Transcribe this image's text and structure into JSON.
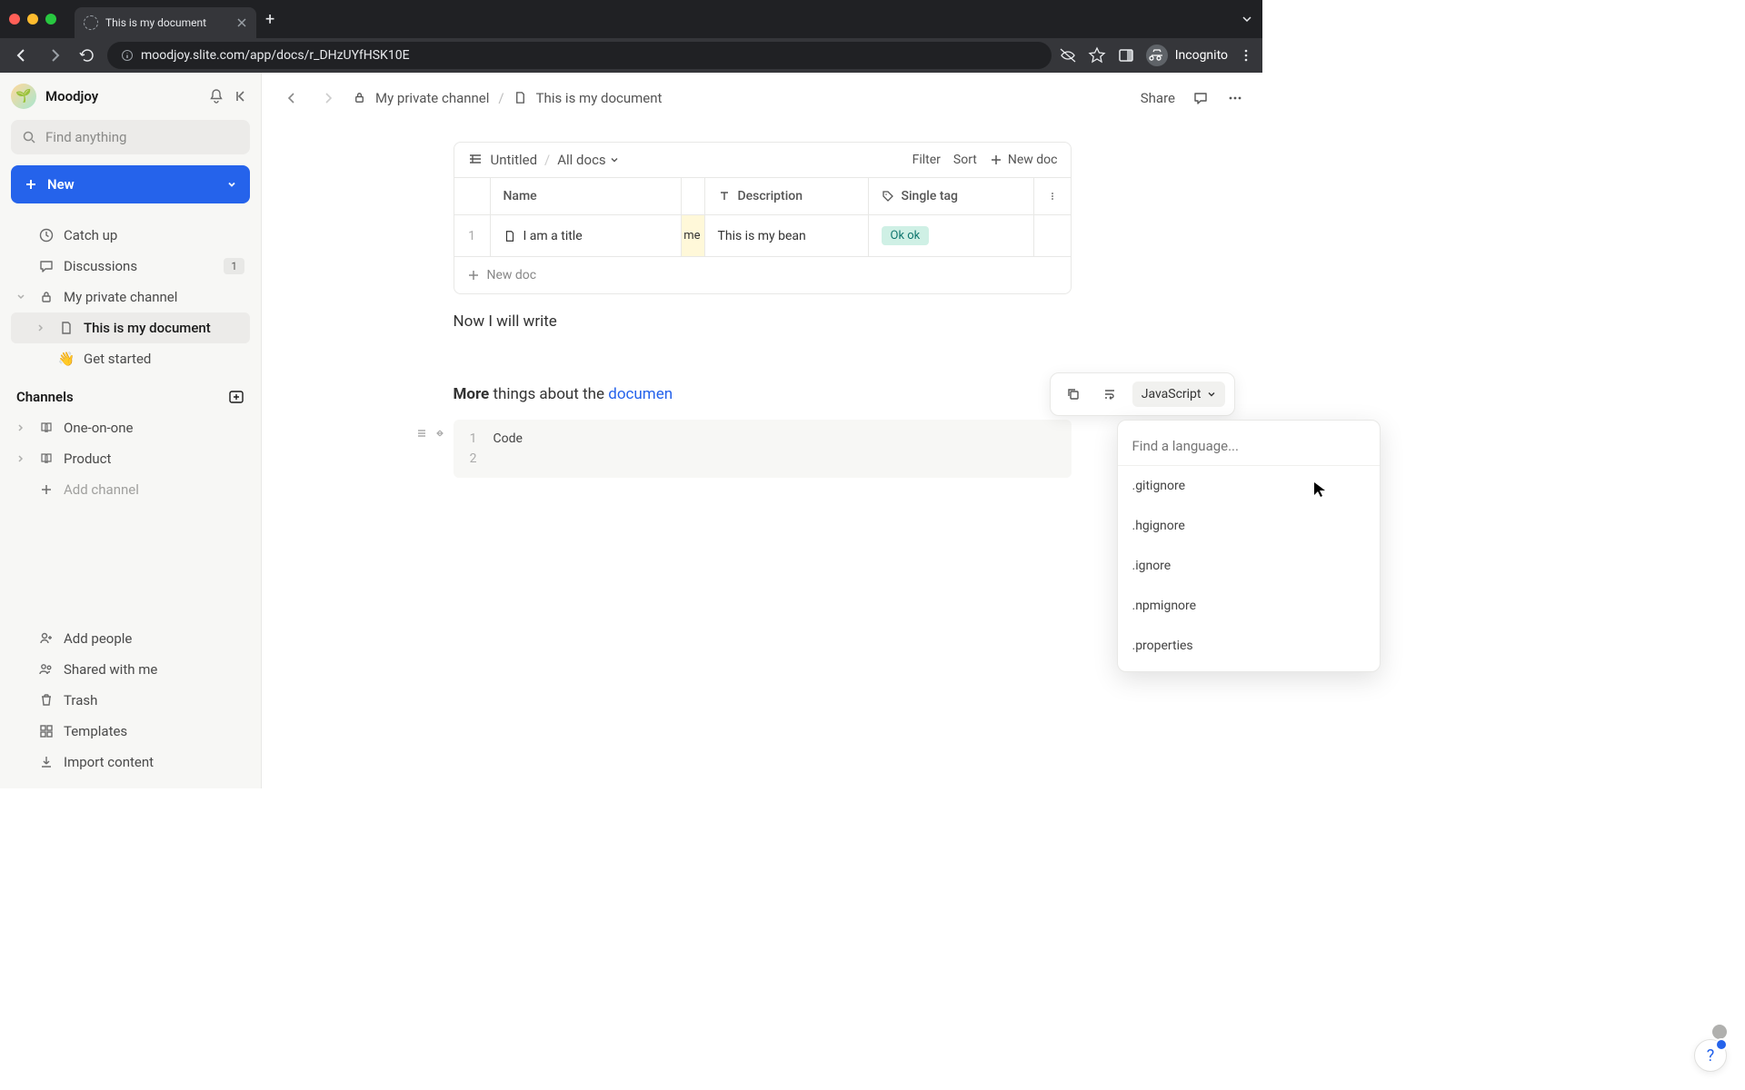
{
  "browser": {
    "tab_title": "This is my document",
    "url": "moodjoy.slite.com/app/docs/r_DHzUYfHSK10E",
    "incognito_label": "Incognito"
  },
  "workspace": {
    "name": "Moodjoy"
  },
  "search": {
    "placeholder": "Find anything"
  },
  "new_button": {
    "label": "New"
  },
  "sidebar": {
    "catch_up": "Catch up",
    "discussions": "Discussions",
    "discussions_badge": "1",
    "private_channel": "My private channel",
    "doc_current": "This is my document",
    "get_started": "Get started",
    "channels_header": "Channels",
    "one_on_one": "One-on-one",
    "product": "Product",
    "add_channel": "Add channel",
    "add_people": "Add people",
    "shared_with_me": "Shared with me",
    "trash": "Trash",
    "templates": "Templates",
    "import_content": "Import content"
  },
  "breadcrumb": {
    "channel": "My private channel",
    "doc": "This is my document"
  },
  "topbar": {
    "share": "Share"
  },
  "table": {
    "untitled": "Untitled",
    "all_docs": "All docs",
    "filter": "Filter",
    "sort": "Sort",
    "new_doc": "New doc",
    "columns": {
      "name": "Name",
      "description": "Description",
      "single_tag": "Single tag"
    },
    "rows": [
      {
        "num": "1",
        "title": "I am a title",
        "remnant": "me",
        "description": "This is my bean",
        "tag": "Ok ok"
      }
    ],
    "add_new_doc": "New doc"
  },
  "body": {
    "paragraph1": "Now I will write",
    "more_word": "More",
    "more_rest": " things about the ",
    "more_link": "documen"
  },
  "code": {
    "line1": "Code",
    "lang_current": "JavaScript",
    "lang_search_placeholder": "Find a language...",
    "lang_options": [
      ".gitignore",
      ".hgignore",
      ".ignore",
      ".npmignore",
      ".properties"
    ]
  }
}
